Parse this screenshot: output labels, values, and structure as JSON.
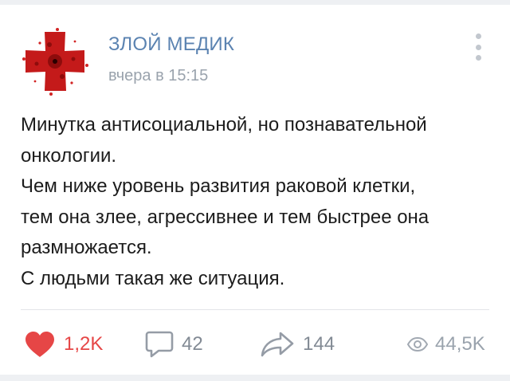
{
  "post": {
    "author": "ЗЛОЙ МЕДИК",
    "time": "вчера в 15:15",
    "lines": [
      "Минутка антисоциальной, но познавательной",
      "онкологии.",
      "Чем ниже уровень развития раковой клетки,",
      "тем она злее, агрессивнее и тем быстрее она",
      "размножается.",
      "С людьми такая же ситуация."
    ]
  },
  "actions": {
    "likes": "1,2K",
    "comments": "42",
    "shares": "144",
    "views": "44,5K"
  },
  "icons": {
    "avatar": "red-cross-icon",
    "menu": "more-vertical-icon",
    "like": "heart-icon",
    "comment": "comment-icon",
    "share": "share-arrow-icon",
    "views": "eye-icon"
  },
  "colors": {
    "author": "#5b83b1",
    "like": "#e64646",
    "muted": "#828a94",
    "avatar_red": "#c41a1a"
  }
}
